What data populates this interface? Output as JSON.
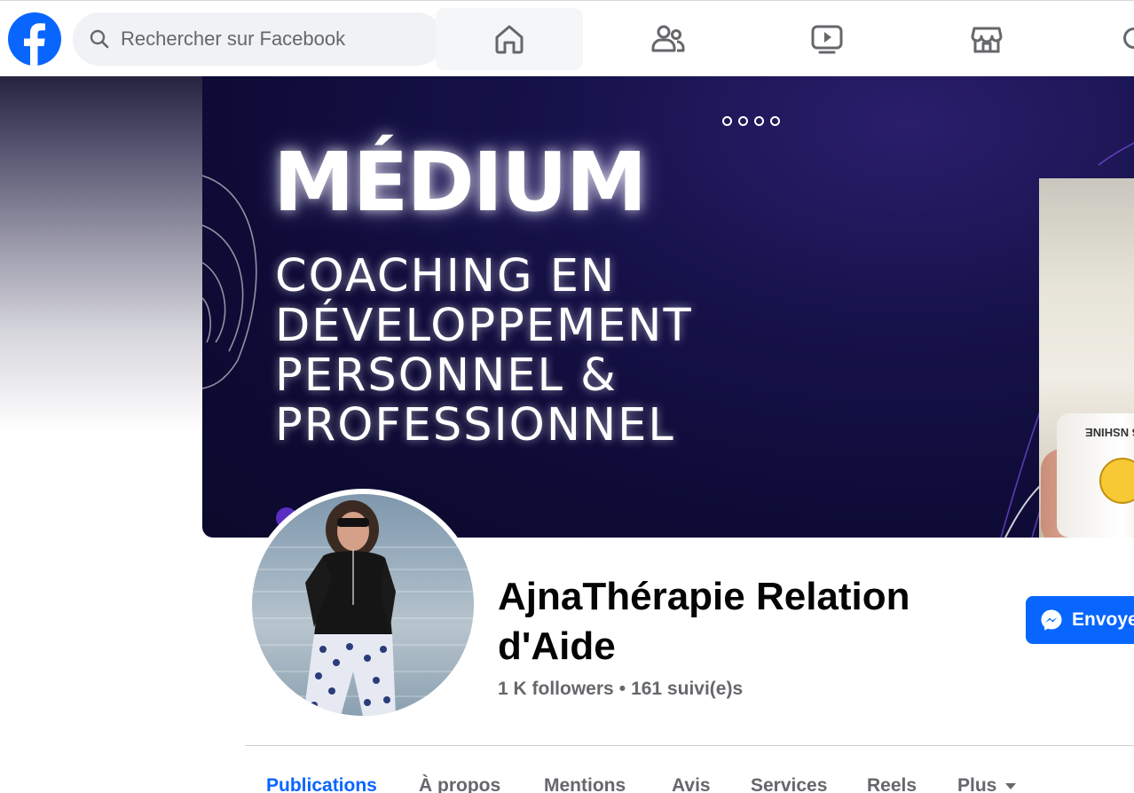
{
  "search": {
    "placeholder": "Rechercher sur Facebook"
  },
  "nav": {
    "items": [
      {
        "name": "home",
        "icon": "home-icon",
        "active": true
      },
      {
        "name": "friends",
        "icon": "friends-icon"
      },
      {
        "name": "video",
        "icon": "video-icon"
      },
      {
        "name": "marketplace",
        "icon": "marketplace-icon"
      }
    ]
  },
  "cover": {
    "title": "MÉDIUM",
    "lines": [
      "COACHING EN",
      "DÉVELOPPEMENT",
      "PERSONNEL &",
      "PROFESSIONNEL"
    ],
    "mug_text": "TITE MISS NSHINE"
  },
  "profile": {
    "name": "AjnaThérapie Relation d'Aide",
    "followers": "1 K followers",
    "separator": "•",
    "following": "161 suivi(e)s"
  },
  "actions": {
    "send_label": "Envoyer"
  },
  "tabs": [
    {
      "label": "Publications",
      "active": true
    },
    {
      "label": "À propos"
    },
    {
      "label": "Mentions"
    },
    {
      "label": "Avis"
    },
    {
      "label": "Services"
    },
    {
      "label": "Reels"
    },
    {
      "label": "Plus"
    }
  ],
  "colors": {
    "brand": "#0866ff",
    "cover_bg": "#0e0b36",
    "secondary_text": "#65676b"
  }
}
